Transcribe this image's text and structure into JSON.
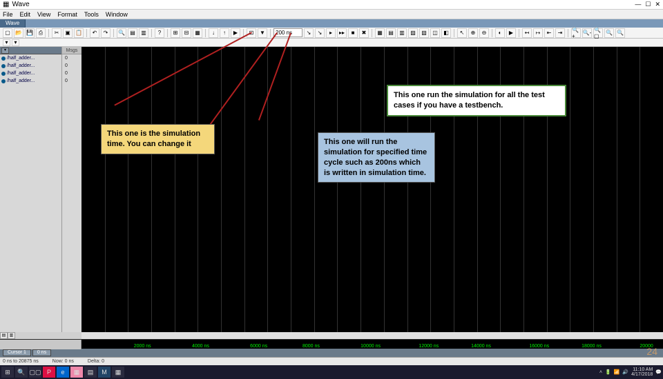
{
  "titlebar": {
    "title": "Wave"
  },
  "window_controls": {
    "min": "—",
    "max": "☐",
    "close": "✕"
  },
  "menu": {
    "file": "File",
    "edit": "Edit",
    "view": "View",
    "format": "Format",
    "tools": "Tools",
    "window": "Window"
  },
  "tabs": {
    "main": "Wave"
  },
  "toolbar": {
    "sim_time": "200 ns"
  },
  "signals": {
    "header_vals": "Msgs",
    "items": [
      {
        "name": "/half_adder...",
        "val": "0"
      },
      {
        "name": "/half_adder...",
        "val": "0"
      },
      {
        "name": "/half_adder...",
        "val": "0"
      },
      {
        "name": "/half_adder...",
        "val": "0"
      }
    ]
  },
  "timeline": {
    "ticks": [
      "2000 ns",
      "4000 ns",
      "6000 ns",
      "8000 ns",
      "10000 ns",
      "12000 ns",
      "14000 ns",
      "16000 ns",
      "18000 ns",
      "20000"
    ]
  },
  "status": {
    "cursor_row": "Cursor 1",
    "cursor_val": "0 ns",
    "range_label": "0 ns to 20875 ns",
    "now_label": "Now:",
    "now_val": "0 ns",
    "delta_label": "Delta: 0"
  },
  "callouts": {
    "sim_time": "This one is the simulation time. You can change it",
    "run_one": "This one will run the simulation for specified time cycle such as 200ns which is written in simulation time.",
    "run_all": "This one run the simulation for all the test cases if you have a testbench."
  },
  "slide_number": "24",
  "taskbar": {
    "time": "11:10 AM",
    "date": "4/17/2018"
  }
}
